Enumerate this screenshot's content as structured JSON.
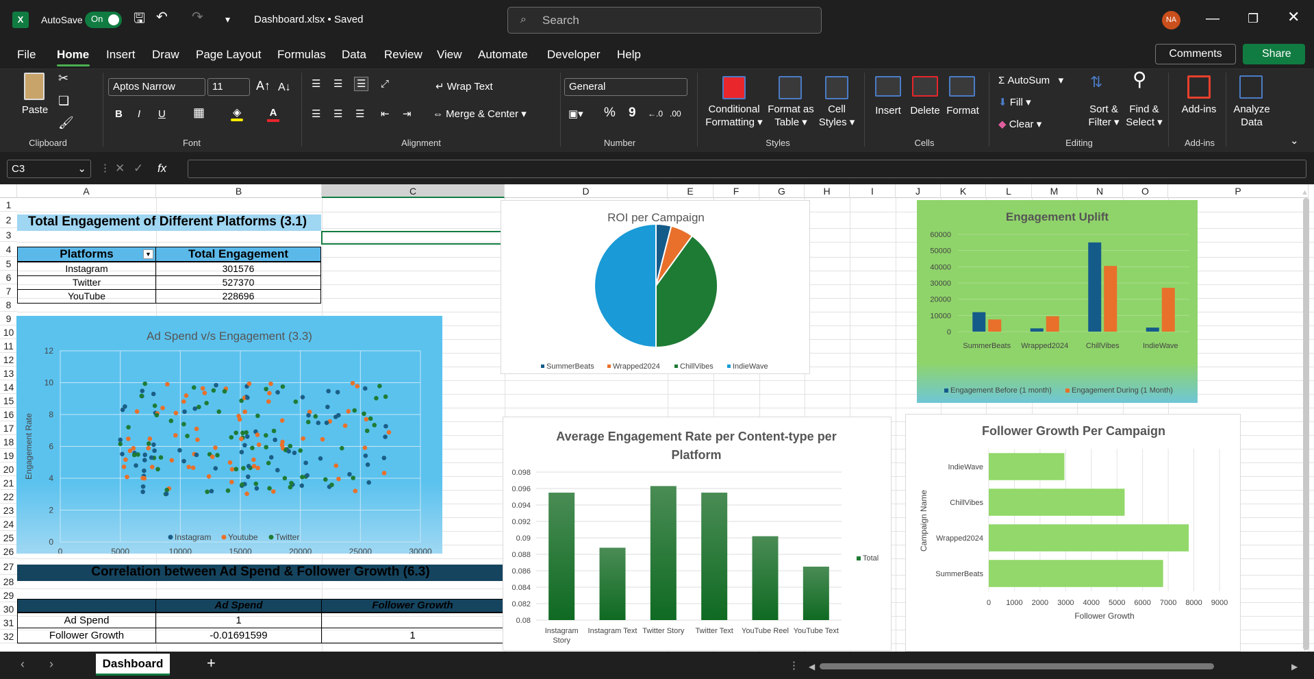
{
  "title_bar": {
    "autosave_label": "AutoSave",
    "autosave_state": "On",
    "filename": "Dashboard.xlsx • Saved",
    "search_placeholder": "Search",
    "avatar_initials": "NA"
  },
  "menu": {
    "items": [
      "File",
      "Home",
      "Insert",
      "Draw",
      "Page Layout",
      "Formulas",
      "Data",
      "Review",
      "View",
      "Automate",
      "Developer",
      "Help"
    ],
    "comments": "Comments",
    "share": "Share"
  },
  "ribbon": {
    "clipboard": {
      "paste": "Paste",
      "group": "Clipboard"
    },
    "font": {
      "name": "Aptos Narrow",
      "size": "11",
      "bold": "B",
      "italic": "I",
      "underline": "U",
      "font_color": "A",
      "group": "Font"
    },
    "alignment": {
      "wrap": "Wrap Text",
      "merge": "Merge & Center",
      "group": "Alignment"
    },
    "number": {
      "format": "General",
      "percent": "%",
      "comma": "9",
      "group": "Number"
    },
    "styles": {
      "conditional": "Conditional",
      "conditional2": "Formatting",
      "format_table": "Format as",
      "format_table2": "Table",
      "cell_styles": "Cell",
      "cell_styles2": "Styles",
      "group": "Styles"
    },
    "cells": {
      "insert": "Insert",
      "delete": "Delete",
      "format": "Format",
      "group": "Cells"
    },
    "editing": {
      "autosum": "AutoSum",
      "fill": "Fill",
      "clear": "Clear",
      "sort": "Sort &",
      "sort2": "Filter",
      "find": "Find &",
      "find2": "Select",
      "group": "Editing"
    },
    "addins": {
      "addins": "Add-ins",
      "group": "Add-ins"
    },
    "analyze": {
      "l1": "Analyze",
      "l2": "Data"
    }
  },
  "formula_bar": {
    "cell_ref": "C3",
    "fx": "fx",
    "content": ""
  },
  "columns": [
    "A",
    "B",
    "C",
    "D",
    "E",
    "F",
    "G",
    "H",
    "I",
    "J",
    "K",
    "L",
    "M",
    "N",
    "O",
    "P"
  ],
  "rows": [
    "1",
    "2",
    "3",
    "4",
    "5",
    "6",
    "7",
    "8",
    "9",
    "10",
    "11",
    "12",
    "13",
    "14",
    "15",
    "16",
    "17",
    "18",
    "19",
    "20",
    "21",
    "22",
    "23",
    "24",
    "25",
    "26",
    "27",
    "28",
    "29",
    "30",
    "31",
    "32"
  ],
  "table1": {
    "title": "Total Engagement of Different Platforms (3.1)",
    "headers": [
      "Platforms",
      "Total Engagement"
    ],
    "rows": [
      [
        "Instagram",
        "301576"
      ],
      [
        "Twitter",
        "527370"
      ],
      [
        "YouTube",
        "228696"
      ]
    ]
  },
  "table2": {
    "title": "Correlation between Ad Spend & Follower Growth (6.3)",
    "headers": [
      "",
      "Ad Spend",
      "Follower Growth"
    ],
    "rows": [
      [
        "Ad Spend",
        "1",
        ""
      ],
      [
        "Follower Growth",
        "-0.01691599",
        "1"
      ]
    ]
  },
  "chart_data": [
    {
      "type": "scatter",
      "title": "Ad Spend v/s Engagement (3.3)",
      "xlabel": "Ad Spend",
      "ylabel": "Engagement Rate",
      "xlim": [
        0,
        30000
      ],
      "ylim": [
        0,
        12
      ],
      "xticks": [
        "0",
        "5000",
        "10000",
        "15000",
        "20000",
        "25000",
        "30000"
      ],
      "yticks": [
        "0",
        "2",
        "4",
        "6",
        "8",
        "10",
        "12"
      ],
      "legend": [
        "Instagram",
        "Youtube",
        "Twitter"
      ],
      "colors": [
        "#1a5e86",
        "#e8702a",
        "#1e7b34"
      ]
    },
    {
      "type": "pie",
      "title": "ROI per Campaign",
      "labels": [
        "SummerBeats",
        "Wrapped2024",
        "ChillVibes",
        "IndieWave"
      ],
      "values": [
        4,
        6,
        40,
        50
      ],
      "colors": [
        "#155b8a",
        "#e8702a",
        "#1e7b34",
        "#1a9ad6"
      ]
    },
    {
      "type": "bar",
      "title": "Engagement Uplift",
      "categories": [
        "SummerBeats",
        "Wrapped2024",
        "ChillVibes",
        "IndieWave"
      ],
      "ylim": [
        0,
        60000
      ],
      "yticks": [
        "0",
        "10000",
        "20000",
        "30000",
        "40000",
        "50000",
        "60000"
      ],
      "series": [
        {
          "name": "Engagement Before (1 month)",
          "values": [
            12000,
            2000,
            55000,
            2500
          ],
          "color": "#155b8a"
        },
        {
          "name": "Engagement During (1 Month)",
          "values": [
            7500,
            9500,
            40500,
            27000
          ],
          "color": "#e8702a"
        }
      ]
    },
    {
      "type": "bar",
      "title": "Average Engagement Rate per Content-type per Platform",
      "categories": [
        "Instagram Story",
        "Instagram Text",
        "Twitter Story",
        "Twitter Text",
        "YouTube Reel",
        "YouTube Text"
      ],
      "ylim": [
        0.08,
        0.098
      ],
      "yticks": [
        "0.08",
        "0.082",
        "0.084",
        "0.086",
        "0.088",
        "0.09",
        "0.092",
        "0.094",
        "0.096",
        "0.098"
      ],
      "series": [
        {
          "name": "Total",
          "values": [
            0.0955,
            0.0888,
            0.0963,
            0.0955,
            0.0902,
            0.0865
          ],
          "color": "#1e7b34"
        }
      ]
    },
    {
      "type": "bar",
      "title": "Follower Growth Per Campaign",
      "categories": [
        "SummerBeats",
        "Wrapped2024",
        "ChillVibes",
        "IndieWave"
      ],
      "xlabel": "Follower Growth",
      "ylabel": "Campaign Name",
      "xlim": [
        0,
        9000
      ],
      "xticks": [
        "0",
        "1000",
        "2000",
        "3000",
        "4000",
        "5000",
        "6000",
        "7000",
        "8000",
        "9000"
      ],
      "series": [
        {
          "values": [
            6800,
            7800,
            5300,
            2950
          ],
          "color": "#92d86a"
        }
      ]
    }
  ],
  "sheet": {
    "tab": "Dashboard",
    "add": "+"
  }
}
